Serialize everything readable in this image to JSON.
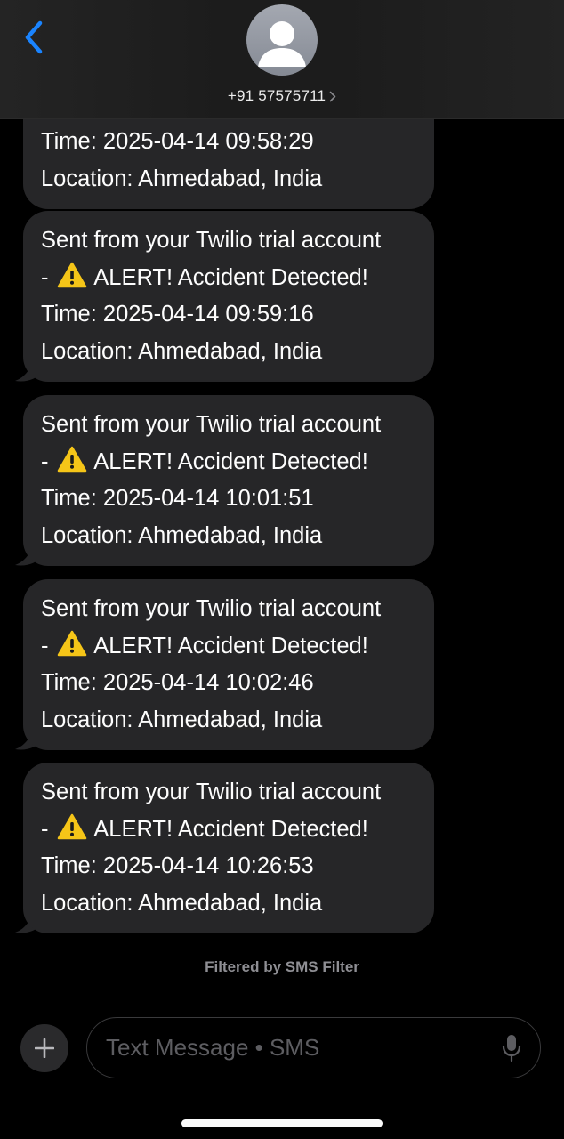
{
  "header": {
    "contact": "+91 57575711",
    "back_icon": "chevron-left-icon",
    "avatar_icon": "person-icon"
  },
  "messages": [
    {
      "lines": [
        "Time: 2025-04-14 09:58:29",
        "Location: Ahmedabad, India"
      ]
    },
    {
      "line1": "Sent from your Twilio trial account",
      "line2_prefix": "-",
      "line2_text": "ALERT! Accident Detected!",
      "time": "Time: 2025-04-14 09:59:16",
      "location": "Location: Ahmedabad, India"
    },
    {
      "line1": "Sent from your Twilio trial account",
      "line2_prefix": "-",
      "line2_text": "ALERT! Accident Detected!",
      "time": "Time: 2025-04-14 10:01:51",
      "location": "Location: Ahmedabad, India"
    },
    {
      "line1": "Sent from your Twilio trial account",
      "line2_prefix": "-",
      "line2_text": "ALERT! Accident Detected!",
      "time": "Time: 2025-04-14 10:02:46",
      "location": "Location: Ahmedabad, India"
    },
    {
      "line1": "Sent from your Twilio trial account",
      "line2_prefix": "-",
      "line2_text": "ALERT! Accident Detected!",
      "time": "Time: 2025-04-14 10:26:53",
      "location": "Location: Ahmedabad, India"
    }
  ],
  "footer": {
    "filter_note": "Filtered by SMS Filter",
    "input_placeholder": "Text Message • SMS",
    "plus_icon": "plus-icon",
    "mic_icon": "microphone-icon"
  },
  "colors": {
    "accent": "#1a84ff",
    "bubble": "#262628",
    "warning": "#f5c518"
  }
}
